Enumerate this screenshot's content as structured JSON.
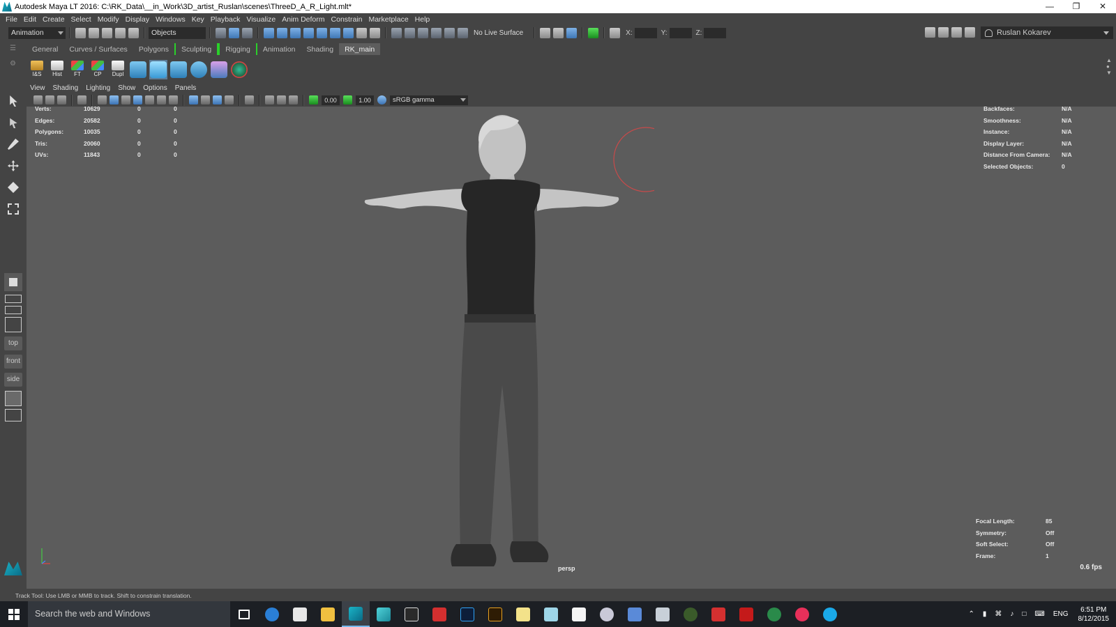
{
  "window": {
    "title": "Autodesk Maya LT 2016: C:\\RK_Data\\__in_Work\\3D_artist_Ruslan\\scenes\\ThreeD_A_R_Light.mlt*"
  },
  "menu": [
    "File",
    "Edit",
    "Create",
    "Select",
    "Modify",
    "Display",
    "Windows",
    "Key",
    "Playback",
    "Visualize",
    "Anim Deform",
    "Constrain",
    "Marketplace",
    "Help"
  ],
  "status_line": {
    "menuset": "Animation",
    "selection_mode": "Objects",
    "live_surface": "No Live Surface",
    "x_label": "X:",
    "y_label": "Y:",
    "z_label": "Z:",
    "user": "Ruslan Kokarev"
  },
  "shelf": {
    "tabs": [
      "General",
      "Curves / Surfaces",
      "Polygons",
      "Sculpting",
      "Rigging",
      "Animation",
      "Shading",
      "RK_main"
    ],
    "active_tab": "RK_main",
    "buttons": [
      "I&S",
      "Hist",
      "FT",
      "CP",
      "Dupl"
    ]
  },
  "toolbox": {
    "views": [
      "top",
      "front",
      "side"
    ]
  },
  "viewport": {
    "menu": [
      "View",
      "Shading",
      "Lighting",
      "Show",
      "Options",
      "Panels"
    ],
    "exposure": "0.00",
    "gamma": "1.00",
    "color_space": "sRGB gamma",
    "camera": "persp",
    "fps": "0.6 fps",
    "hud_left": [
      {
        "label": "Verts:",
        "v1": "10629",
        "v2": "0",
        "v3": "0"
      },
      {
        "label": "Edges:",
        "v1": "20582",
        "v2": "0",
        "v3": "0"
      },
      {
        "label": "Polygons:",
        "v1": "10035",
        "v2": "0",
        "v3": "0"
      },
      {
        "label": "Tris:",
        "v1": "20060",
        "v2": "0",
        "v3": "0"
      },
      {
        "label": "UVs:",
        "v1": "11843",
        "v2": "0",
        "v3": "0"
      }
    ],
    "hud_right": [
      {
        "label": "Backfaces:",
        "value": "N/A"
      },
      {
        "label": "Smoothness:",
        "value": "N/A"
      },
      {
        "label": "Instance:",
        "value": "N/A"
      },
      {
        "label": "Display Layer:",
        "value": "N/A"
      },
      {
        "label": "Distance From Camera:",
        "value": "N/A"
      },
      {
        "label": "Selected Objects:",
        "value": "0"
      }
    ],
    "hud_bottom_right": [
      {
        "label": "Focal Length:",
        "value": "85"
      },
      {
        "label": "Symmetry:",
        "value": "Off"
      },
      {
        "label": "Soft Select:",
        "value": "Off"
      },
      {
        "label": "Frame:",
        "value": "1"
      }
    ]
  },
  "help_line": "Track Tool: Use LMB or MMB to track. Shift to constrain translation.",
  "taskbar": {
    "search_placeholder": "Search the web and Windows",
    "tray_lang": "ENG",
    "time": "6:51 PM",
    "date": "8/12/2015"
  },
  "colors": {
    "ui_bg": "#444444",
    "viewport_bg": "#5c5c5c",
    "active_tab": "#5d5d5d",
    "bracket_green": "#2ad02a",
    "taskbar_bg": "#1c1f24"
  }
}
